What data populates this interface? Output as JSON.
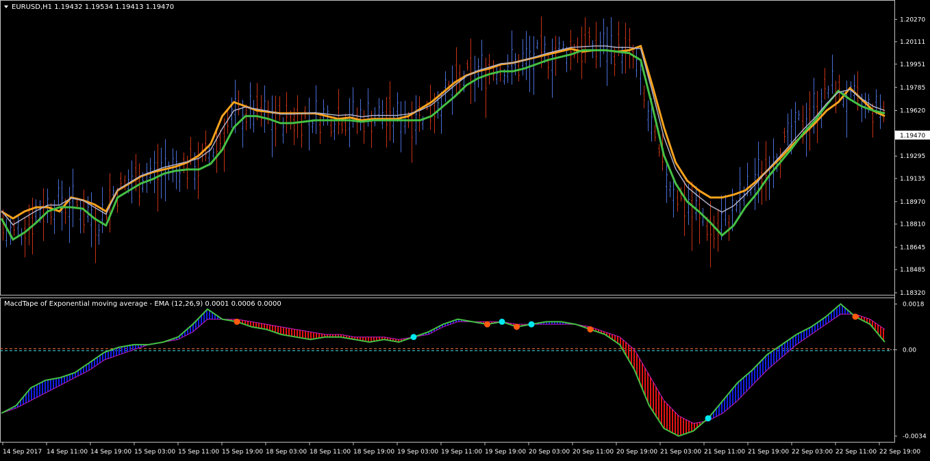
{
  "window": {
    "symbol_title": "EURUSD,H1  1.19432 1.19534 1.19413 1.19470",
    "current_price_label": "1.19470"
  },
  "price_axis": {
    "ticks": [
      "1.20270",
      "1.20111",
      "1.19951",
      "1.19785",
      "1.19620",
      "1.19295",
      "1.19135",
      "1.18970",
      "1.18810",
      "1.18645",
      "1.18485",
      "1.18320"
    ],
    "tick_values": [
      1.2027,
      1.20111,
      1.19951,
      1.19785,
      1.1962,
      1.19295,
      1.19135,
      1.1897,
      1.1881,
      1.18645,
      1.18485,
      1.1832
    ]
  },
  "indicator": {
    "title": "MacdTape of Exponential moving average - EMA (12,26,9) 0.0001 0.0006 0.0000",
    "axis_ticks": [
      "0.0018",
      "0.00",
      "-0.0034"
    ],
    "axis_values": [
      0.0018,
      0.0,
      -0.0034
    ]
  },
  "time_axis": {
    "labels": [
      "14 Sep 2017",
      "14 Sep 11:00",
      "14 Sep 19:00",
      "15 Sep 03:00",
      "15 Sep 11:00",
      "15 Sep 19:00",
      "18 Sep 03:00",
      "18 Sep 11:00",
      "18 Sep 19:00",
      "19 Sep 03:00",
      "19 Sep 11:00",
      "19 Sep 19:00",
      "20 Sep 03:00",
      "20 Sep 11:00",
      "20 Sep 19:00",
      "21 Sep 03:00",
      "21 Sep 11:00",
      "21 Sep 19:00",
      "22 Sep 03:00",
      "22 Sep 11:00",
      "22 Sep 19:00"
    ]
  },
  "colors": {
    "background": "#000000",
    "bull_bar": "#4a6fd8",
    "bear_bar": "#c83214",
    "ema_green": "#44c044",
    "ema_orange": "#f7a21d",
    "ema_gray": "#b0b0c8",
    "macd_green": "#44c044",
    "signal_purple": "#c81ec8",
    "tape_blue": "#1420e6",
    "tape_red": "#e61414",
    "zero_orange": "#ff7040",
    "zero_cyan": "#40e0e8",
    "dot_cyan": "#00e8f0",
    "dot_orange": "#ff5a10"
  },
  "chart_data": {
    "type": "line",
    "price_ylim": [
      1.1832,
      1.2035
    ],
    "price_series": [
      {
        "name": "",
        "color": "green",
        "values": [
          1.1885,
          1.187,
          1.1875,
          1.1882,
          1.189,
          1.1893,
          1.1893,
          1.1892,
          1.1885,
          1.188,
          1.19,
          1.1905,
          1.191,
          1.1913,
          1.1917,
          1.1919,
          1.192,
          1.192,
          1.1924,
          1.1934,
          1.195,
          1.1958,
          1.1958,
          1.1956,
          1.1953,
          1.1953,
          1.1954,
          1.1955,
          1.1955,
          1.1955,
          1.1955,
          1.1954,
          1.1955,
          1.1955,
          1.1955,
          1.1955,
          1.1955,
          1.1958,
          1.1965,
          1.1972,
          1.198,
          1.1985,
          1.1988,
          1.199,
          1.199,
          1.1992,
          1.1995,
          1.1998,
          1.2,
          1.2002,
          1.2005,
          1.2005,
          1.2005,
          1.2004,
          1.2003,
          1.1998,
          1.1965,
          1.193,
          1.191,
          1.1897,
          1.189,
          1.1882,
          1.1873,
          1.188,
          1.1893,
          1.1903,
          1.1915,
          1.1925,
          1.1935,
          1.1946,
          1.1955,
          1.1966,
          1.1976,
          1.197,
          1.1965,
          1.1962,
          1.196
        ]
      },
      {
        "name": "",
        "color": "orange",
        "values": [
          1.189,
          1.1885,
          1.189,
          1.1893,
          1.1893,
          1.189,
          1.19,
          1.1898,
          1.1895,
          1.189,
          1.1905,
          1.191,
          1.1915,
          1.1918,
          1.192,
          1.1922,
          1.1925,
          1.193,
          1.1938,
          1.1958,
          1.1968,
          1.1965,
          1.1962,
          1.1961,
          1.196,
          1.196,
          1.196,
          1.196,
          1.1958,
          1.1956,
          1.1957,
          1.1955,
          1.1956,
          1.1956,
          1.1956,
          1.1958,
          1.1963,
          1.1968,
          1.1975,
          1.1982,
          1.1987,
          1.199,
          1.1992,
          1.1995,
          1.1996,
          1.1998,
          1.2,
          1.2002,
          1.2004,
          1.2006,
          1.2004,
          1.2005,
          1.2005,
          1.2004,
          1.2005,
          1.2008,
          1.198,
          1.195,
          1.1925,
          1.1912,
          1.1905,
          1.19,
          1.19,
          1.1902,
          1.1905,
          1.1912,
          1.192,
          1.1928,
          1.1937,
          1.1945,
          1.1953,
          1.1962,
          1.1968,
          1.1978,
          1.197,
          1.1962,
          1.1958
        ]
      }
    ],
    "macd_ylim": [
      -0.0036,
      0.002
    ],
    "macd_line": [
      -0.0025,
      -0.0022,
      -0.0015,
      -0.0012,
      -0.0011,
      -0.0009,
      -0.0005,
      -0.0001,
      0.0001,
      0.0002,
      0.0002,
      0.0003,
      0.0005,
      0.001,
      0.0016,
      0.0012,
      0.0011,
      0.0009,
      0.0008,
      0.0006,
      0.0005,
      0.0004,
      0.0005,
      0.0005,
      0.0004,
      0.0003,
      0.0004,
      0.0003,
      0.0005,
      0.0007,
      0.001,
      0.0012,
      0.0011,
      0.001,
      0.0011,
      0.0009,
      0.001,
      0.0011,
      0.0011,
      0.001,
      0.0008,
      0.0006,
      0.0002,
      -0.0008,
      -0.0022,
      -0.0031,
      -0.0034,
      -0.0032,
      -0.0027,
      -0.002,
      -0.0013,
      -0.0008,
      -0.0002,
      0.0002,
      0.0006,
      0.0009,
      0.0013,
      0.0018,
      0.0013,
      0.001,
      0.0003
    ],
    "signal_line": [
      -0.0025,
      -0.0023,
      -0.002,
      -0.0017,
      -0.0014,
      -0.0011,
      -0.0008,
      -0.0004,
      -0.0002,
      0.0,
      0.0002,
      0.0003,
      0.0004,
      0.0007,
      0.0012,
      0.0012,
      0.0012,
      0.0011,
      0.001,
      0.0009,
      0.0008,
      0.0007,
      0.0006,
      0.0006,
      0.0005,
      0.0005,
      0.0005,
      0.0004,
      0.0005,
      0.0006,
      0.0009,
      0.0011,
      0.0011,
      0.0011,
      0.0011,
      0.001,
      0.001,
      0.001,
      0.001,
      0.001,
      0.0009,
      0.0007,
      0.0005,
      0.0,
      -0.001,
      -0.002,
      -0.0026,
      -0.0029,
      -0.0028,
      -0.0025,
      -0.002,
      -0.0014,
      -0.0008,
      -0.0003,
      0.0002,
      0.0006,
      0.001,
      0.0014,
      0.0014,
      0.0012,
      0.0008
    ]
  }
}
